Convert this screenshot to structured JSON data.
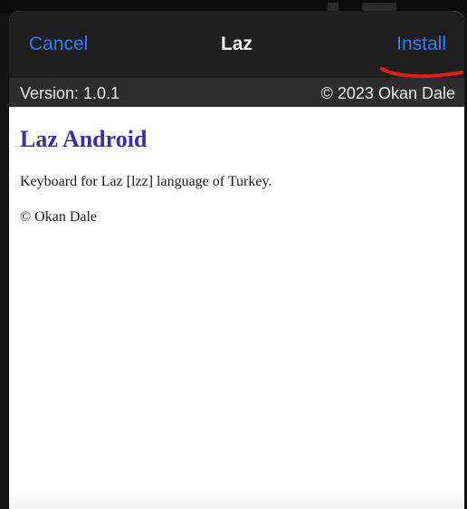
{
  "nav": {
    "cancel_label": "Cancel",
    "title": "Laz",
    "install_label": "Install"
  },
  "info_bar": {
    "version": "Version: 1.0.1",
    "copyright": "© 2023 Okan Dale"
  },
  "package": {
    "title": "Laz Android",
    "description": "Keyboard for Laz [lzz] language of Turkey.",
    "author": "© Okan Dale"
  },
  "colors": {
    "link_blue": "#2f7ef6",
    "title_purple": "#3a2fa8",
    "annotation_red": "#e11d1d",
    "nav_background": "#1f1f1f",
    "info_background": "#2e2e2e"
  }
}
